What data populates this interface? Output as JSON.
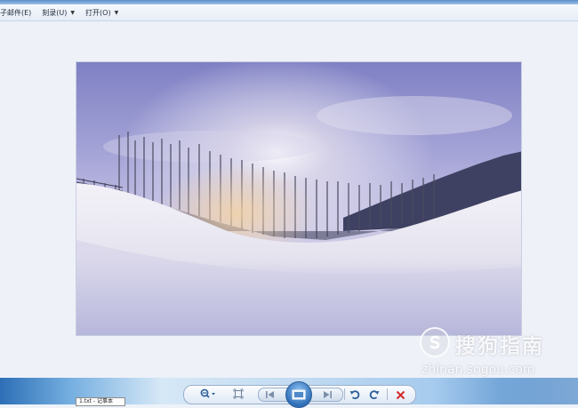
{
  "menubar": {
    "items": [
      {
        "label": "子邮件(E)",
        "has_caret": false
      },
      {
        "label": "刻录(U)",
        "has_caret": true
      },
      {
        "label": "打开(O)",
        "has_caret": true
      }
    ]
  },
  "watermark": {
    "title": "搜狗指南",
    "url": "zhinan.sogou.com"
  },
  "toolbar": {
    "buttons": [
      "zoom-button",
      "fit-button",
      "previous-button",
      "slideshow-button",
      "next-button",
      "rotate-left-button",
      "rotate-right-button",
      "delete-button"
    ]
  },
  "taskbar": {
    "notepad_label": "1.txt - 记事本"
  },
  "colors": {
    "control_blue": "#2c5f9a",
    "delete_red": "#d42a2a",
    "taskbar_blue": "#2d6fb6"
  }
}
